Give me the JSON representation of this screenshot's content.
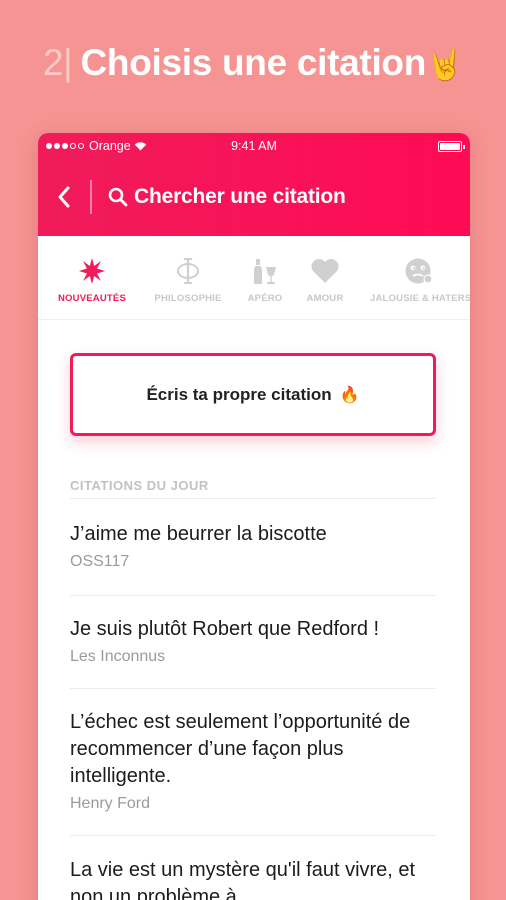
{
  "headline": {
    "number": "2",
    "separator": "|",
    "text": "Choisis une citation",
    "emoji": "🤘"
  },
  "status_bar": {
    "carrier": "Orange",
    "time": "9:41 AM"
  },
  "nav": {
    "search_label": "Chercher une citation"
  },
  "tabs": [
    {
      "label": "NOUVEAUTÉS",
      "icon": "sparkle-icon",
      "active": true
    },
    {
      "label": "PHILOSOPHIE",
      "icon": "phi-icon",
      "active": false
    },
    {
      "label": "APÉRO",
      "icon": "bottle-glass-icon",
      "active": false
    },
    {
      "label": "AMOUR",
      "icon": "heart-icon",
      "active": false
    },
    {
      "label": "JALOUSIE & HATERS",
      "icon": "face-icon",
      "active": false
    }
  ],
  "write_button": {
    "label": "Écris ta propre citation",
    "emoji": "🔥"
  },
  "section": {
    "title": "CITATIONS DU JOUR"
  },
  "quotes": [
    {
      "text": "J’aime me beurrer la biscotte",
      "author": "OSS117"
    },
    {
      "text": "Je suis plutôt Robert que Redford !",
      "author": "Les Inconnus"
    },
    {
      "text": "L’échec est seulement l’opportunité de recommencer d’une façon plus intelligente.",
      "author": "Henry Ford"
    },
    {
      "text": "La vie est un mystère qu'il faut vivre, et non un problème à",
      "author": ""
    }
  ],
  "colors": {
    "accent": "#f01c5a",
    "background": "#f59492",
    "inactive": "#c8c8c8"
  }
}
